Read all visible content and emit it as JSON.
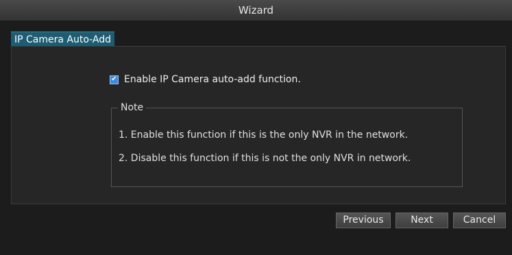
{
  "window": {
    "title": "Wizard"
  },
  "tab": {
    "label": "IP Camera Auto-Add"
  },
  "option": {
    "label": "Enable IP Camera auto-add function.",
    "checked": true
  },
  "note": {
    "title": "Note",
    "lines": [
      "1. Enable this function if this is the only NVR in the network.",
      "2. Disable this function if this is not the only NVR in network."
    ]
  },
  "buttons": {
    "previous": "Previous",
    "next": "Next",
    "cancel": "Cancel"
  },
  "colors": {
    "tab_active": "#1d5d73",
    "checkbox": "#3d8be0",
    "background": "#1c1c1c"
  }
}
